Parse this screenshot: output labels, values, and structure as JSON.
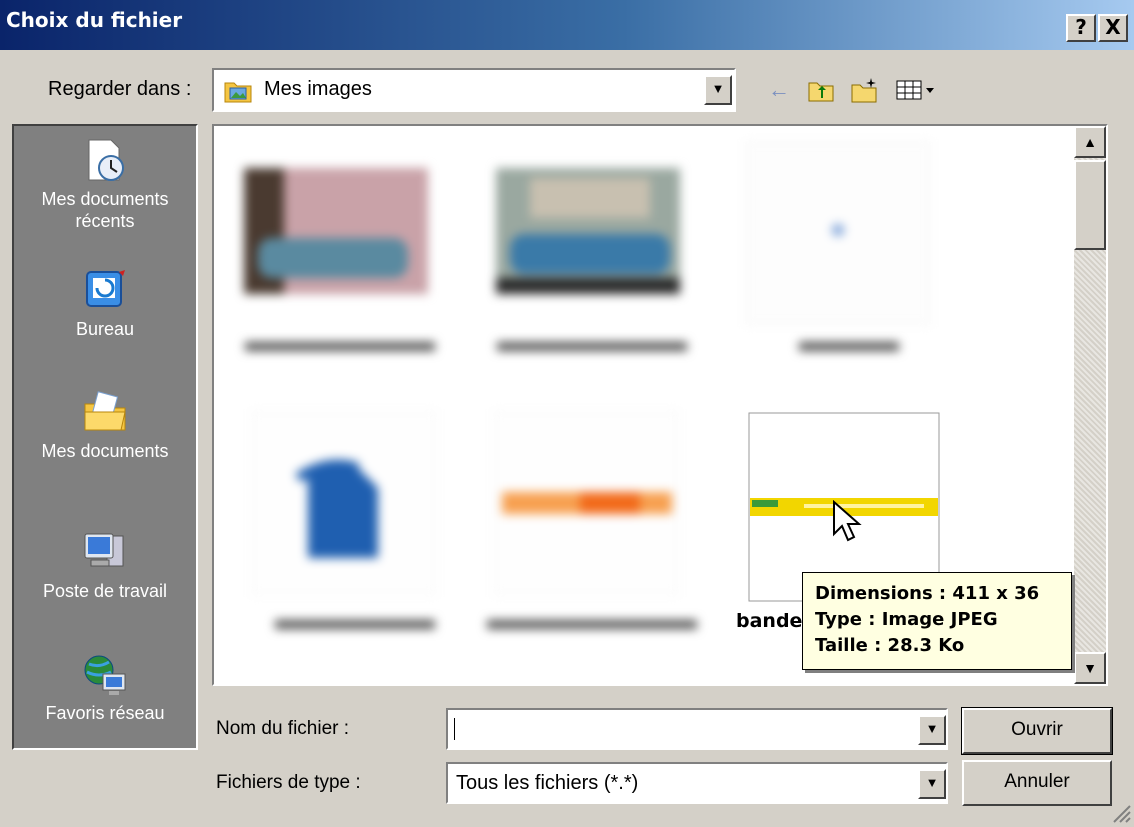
{
  "window": {
    "title": "Choix du fichier",
    "help_label": "?",
    "close_label": "X"
  },
  "lookin": {
    "label": "Regarder dans :",
    "value": "Mes images",
    "icon": "my-pictures-folder-icon"
  },
  "toolbar": {
    "back_icon": "←",
    "up_icon": "up-folder-icon",
    "new_folder_icon": "new-folder-icon",
    "view_menu_icon": "view-menu-icon"
  },
  "places": [
    {
      "label": "Mes documents récents",
      "icon": "recent-documents-icon"
    },
    {
      "label": "Bureau",
      "icon": "desktop-icon"
    },
    {
      "label": "Mes documents",
      "icon": "my-documents-icon"
    },
    {
      "label": "Poste de travail",
      "icon": "my-computer-icon"
    },
    {
      "label": "Favoris réseau",
      "icon": "network-places-icon"
    }
  ],
  "files": [
    {
      "label": "",
      "blurred": true
    },
    {
      "label": "",
      "blurred": true
    },
    {
      "label": "",
      "blurred": true
    },
    {
      "label": "",
      "blurred": true
    },
    {
      "label": "",
      "blurred": true
    },
    {
      "label": "bande",
      "blurred": false,
      "selected": true
    }
  ],
  "tooltip": {
    "dimensions": "Dimensions : 411 x 36",
    "type": "Type : Image JPEG",
    "size": "Taille : 28.3 Ko"
  },
  "filename": {
    "label": "Nom du fichier :",
    "value": ""
  },
  "filetype": {
    "label": "Fichiers de type :",
    "value": "Tous les fichiers (*.*)"
  },
  "buttons": {
    "open": "Ouvrir",
    "cancel": "Annuler"
  },
  "colors": {
    "titlebar_start": "#0a246a",
    "titlebar_end": "#a6caf0",
    "dialog_bg": "#d4d0c8",
    "places_bg": "#808080",
    "tooltip_bg": "#ffffe1"
  }
}
